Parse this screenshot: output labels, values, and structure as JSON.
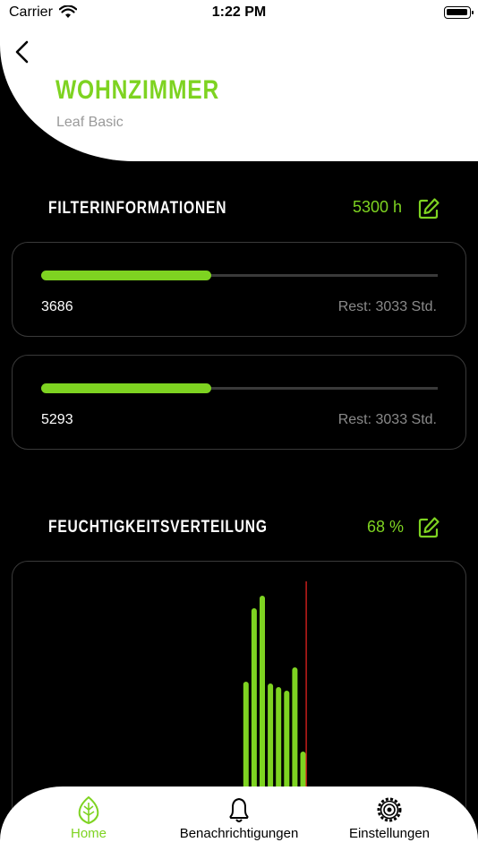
{
  "status_bar": {
    "carrier": "Carrier",
    "time": "1:22 PM"
  },
  "header": {
    "title": "WOHNZIMMER",
    "subtitle": "Leaf Basic"
  },
  "filter_section": {
    "title": "FILTERINFORMATIONEN",
    "value": "5300 h",
    "cards": [
      {
        "number": "3686",
        "rest": "Rest: 3033 Std.",
        "progress": 0.43
      },
      {
        "number": "5293",
        "rest": "Rest: 3033 Std.",
        "progress": 0.43
      }
    ]
  },
  "humidity_section": {
    "title": "FEUCHTIGKEITSVERTEILUNG",
    "value": "68 %"
  },
  "chart_data": {
    "type": "bar",
    "values": [
      0,
      0,
      0,
      0,
      0,
      0,
      0,
      0,
      0,
      0,
      0,
      0,
      0,
      0,
      0,
      0,
      0,
      0,
      0,
      0,
      0,
      0,
      0,
      0,
      0,
      0,
      0,
      0,
      0,
      0,
      0,
      0,
      0,
      0,
      0,
      0,
      0,
      0,
      0,
      0,
      0,
      0,
      0,
      0,
      0,
      0,
      0,
      0,
      0,
      0,
      0,
      0,
      0,
      0,
      0,
      0,
      0,
      0,
      59,
      100,
      107,
      58,
      56,
      54,
      67,
      20,
      0,
      0
    ],
    "marker_index": 66,
    "colors": {
      "bar": "#7ed321",
      "marker": "#e0201e"
    }
  },
  "tabbar": {
    "items": [
      {
        "label": "Home",
        "icon": "leaf-icon",
        "active": true
      },
      {
        "label": "Benachrichtigungen",
        "icon": "bell-icon",
        "active": false
      },
      {
        "label": "Einstellungen",
        "icon": "gear-icon",
        "active": false
      }
    ]
  },
  "colors": {
    "accent": "#7ed321",
    "background": "#000000",
    "card_border": "#3a3a3a",
    "muted": "#8a8a8a"
  }
}
